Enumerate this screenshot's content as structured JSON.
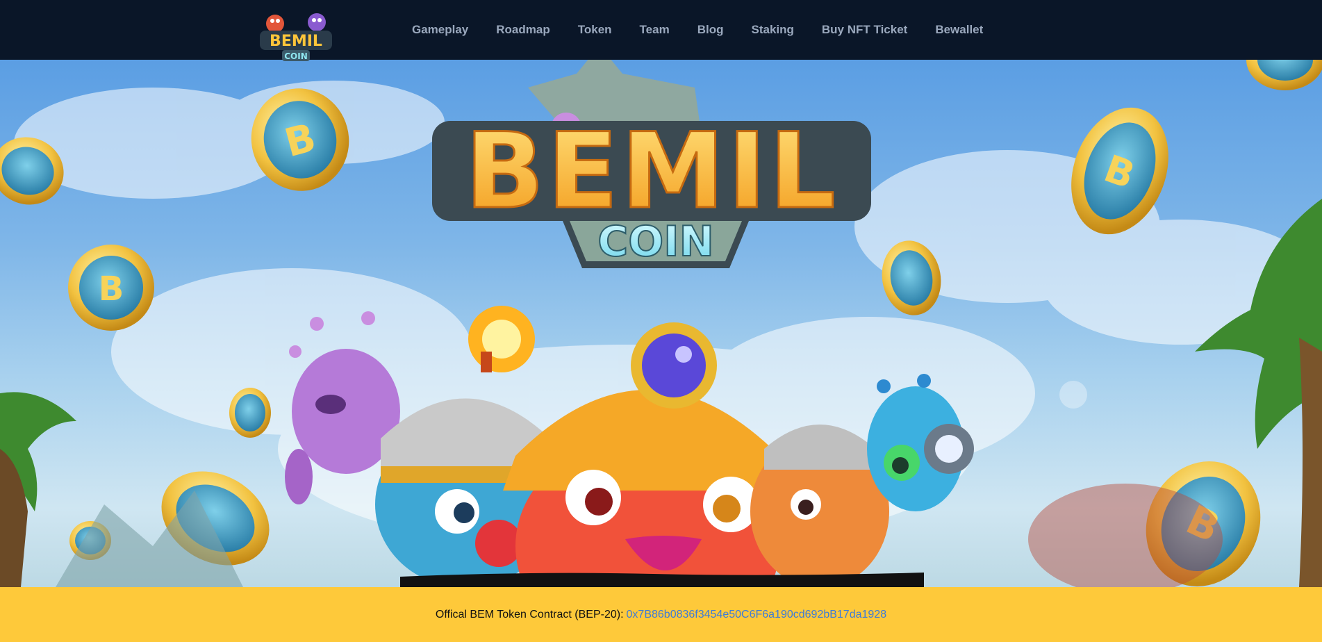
{
  "brand": {
    "logo_text_top": "BEMIL",
    "logo_text_bottom": "COIN"
  },
  "nav": {
    "items": [
      {
        "label": "Gameplay"
      },
      {
        "label": "Roadmap"
      },
      {
        "label": "Token"
      },
      {
        "label": "Team"
      },
      {
        "label": "Blog"
      },
      {
        "label": "Staking"
      },
      {
        "label": "Buy NFT Ticket"
      },
      {
        "label": "Bewallet"
      }
    ]
  },
  "hero": {
    "title": "BEMIL",
    "subtitle": "COIN",
    "coin_letter": "B"
  },
  "contract": {
    "label": "Offical BEM Token Contract (BEP-20):",
    "address": "0x7B86b0836f3454e50C6F6a190cd692bB17da1928"
  },
  "colors": {
    "header_bg": "#0a1628",
    "nav_text": "#9aa8bd",
    "bar_bg": "#fec93a",
    "link": "#3d7bd8"
  }
}
